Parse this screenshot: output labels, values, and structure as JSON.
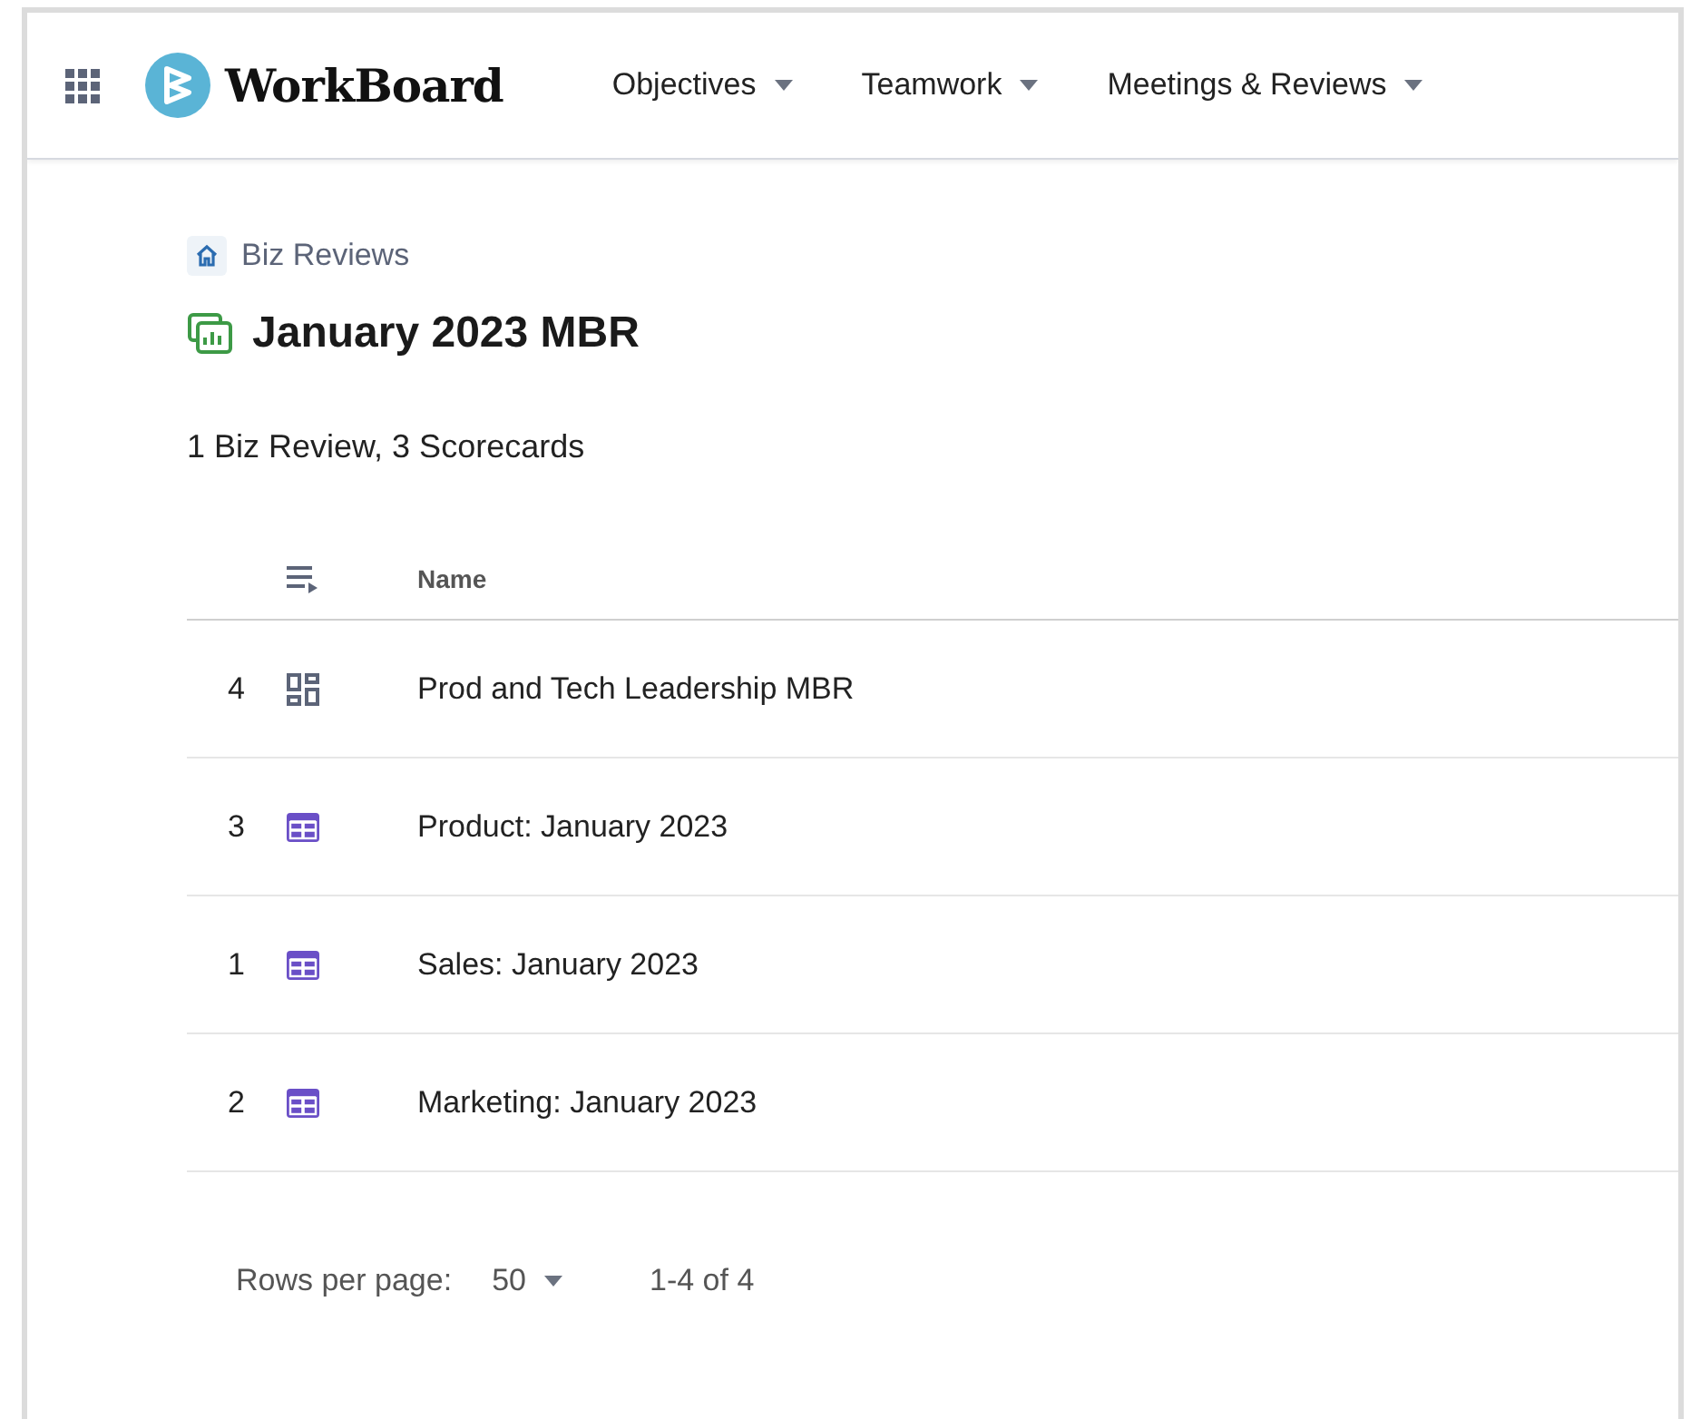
{
  "app": {
    "logo_text": "WorkBoard"
  },
  "nav": [
    {
      "label": "Objectives"
    },
    {
      "label": "Teamwork"
    },
    {
      "label": "Meetings & Reviews"
    }
  ],
  "breadcrumb": "Biz Reviews",
  "title": "January 2023 MBR",
  "summary": "1 Biz Review, 3 Scorecards",
  "table": {
    "columns": [
      "Name"
    ],
    "rows": [
      {
        "number": "4",
        "kind": "biz-review",
        "name": "Prod and Tech Leadership MBR"
      },
      {
        "number": "3",
        "kind": "scorecard",
        "name": "Product: January 2023"
      },
      {
        "number": "1",
        "kind": "scorecard",
        "name": "Sales: January 2023"
      },
      {
        "number": "2",
        "kind": "scorecard",
        "name": "Marketing: January 2023"
      }
    ]
  },
  "pagination": {
    "label": "Rows per page:",
    "rows_per_page": "50",
    "range": "1-4 of 4"
  }
}
